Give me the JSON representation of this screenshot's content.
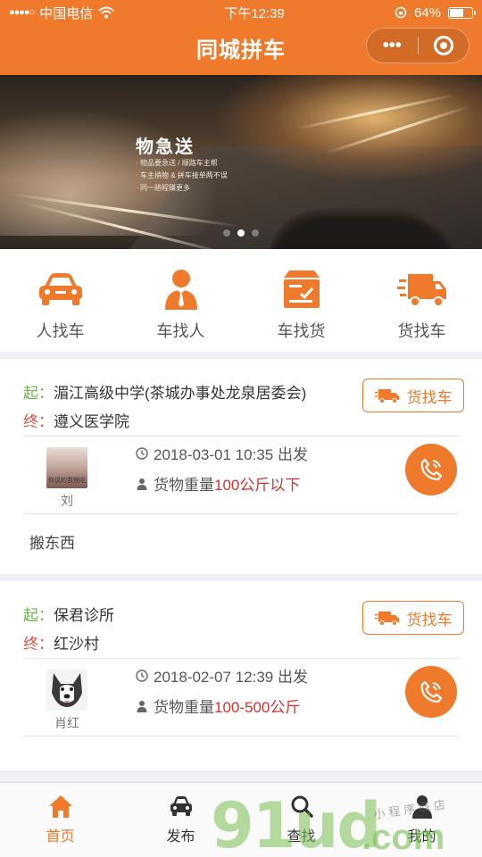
{
  "status": {
    "carrier": "中国电信",
    "time": "下午12:39",
    "battery": "64%",
    "battery_level": 0.64
  },
  "nav": {
    "title": "同城拼车",
    "more": "•••"
  },
  "banner": {
    "title": "物急送",
    "lines": [
      "物品要急送 / 顺路车主帮",
      "车主捎物 & 拼车接单两不误",
      "同一趟程赚更多"
    ],
    "slides": 3,
    "active_slide": 1
  },
  "categories": [
    {
      "label": "人找车",
      "icon": "car-icon"
    },
    {
      "label": "车找人",
      "icon": "person-icon"
    },
    {
      "label": "车找货",
      "icon": "cargo-box-icon"
    },
    {
      "label": "货找车",
      "icon": "truck-icon"
    }
  ],
  "listings": [
    {
      "start_label": "起：",
      "start": "湄江高级中学(茶城办事处龙泉居委会)",
      "end_label": "终：",
      "end": "遵义医学院",
      "tag": "货找车",
      "user": "刘",
      "avatar_text": "你说的我就吃",
      "depart": "2018-03-01 10:35 出发",
      "weight_label": "货物重量",
      "weight": "100公斤以下",
      "note": "搬东西"
    },
    {
      "start_label": "起：",
      "start": "保君诊所",
      "end_label": "终：",
      "end": "红沙村",
      "tag": "货找车",
      "user": "肖红",
      "depart": "2018-02-07 12:39 出发",
      "weight_label": "货物重量",
      "weight": "100-500公斤"
    }
  ],
  "tabs": [
    {
      "label": "首页",
      "icon": "home-icon",
      "active": true
    },
    {
      "label": "发布",
      "icon": "car-icon",
      "active": false
    },
    {
      "label": "查找",
      "icon": "search-icon",
      "active": false
    },
    {
      "label": "我的",
      "icon": "user-icon",
      "active": false
    }
  ],
  "watermark": {
    "main": "91ud",
    "sub": ".com",
    "shop": "小程序商店"
  },
  "colors": {
    "brand": "#f07a2c",
    "start": "#67b547",
    "end": "#e24d3d",
    "highlight": "#d7322a"
  }
}
